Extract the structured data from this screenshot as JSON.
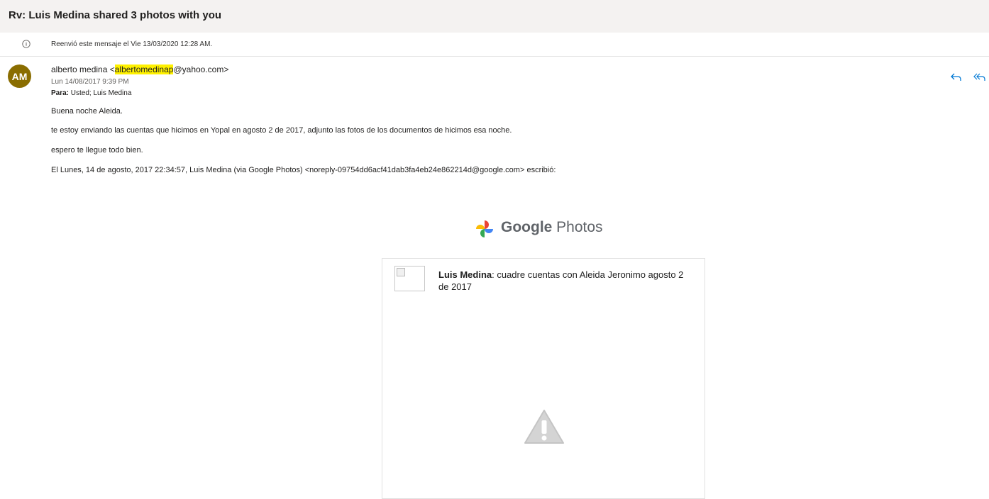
{
  "message": {
    "subject": "Rv: Luis Medina shared 3 photos with you",
    "forward_notice": "Reenvió este mensaje el Vie 13/03/2020 12:28 AM.",
    "avatar_initials": "AM",
    "avatar_color": "#8a6d00",
    "sender_name_prefix": "alberto medina <",
    "sender_highlight": "albertomedinap",
    "sender_suffix": "@yahoo.com>",
    "date": "Lun 14/08/2017 9:39 PM",
    "to_label": "Para:",
    "to_value": "Usted; Luis Medina",
    "actions": {
      "reply_icon": "reply-icon",
      "reply_all_icon": "reply-all-icon"
    }
  },
  "body": {
    "line1": "Buena noche Aleida.",
    "line2": "te estoy enviando las cuentas que hicimos en Yopal en agosto 2 de 2017, adjunto las fotos de los documentos de hicimos esa noche.",
    "line3": "espero te llegue todo bien.",
    "line4": "El Lunes, 14 de agosto, 2017 22:34:57, Luis Medina (via Google Photos) <noreply-09754dd6acf41dab3fa4eb24e862214d@google.com> escribió:"
  },
  "google_photos": {
    "brand_g": "Google",
    "brand_rest": " Photos",
    "card_sender": "Luis Medina",
    "card_text": ": cuadre cuentas con Aleida Jeronimo agosto 2 de 2017"
  },
  "colors": {
    "highlight": "#fff100",
    "accent_blue": "#0078d4",
    "subject_bar": "#f4f2f1"
  }
}
